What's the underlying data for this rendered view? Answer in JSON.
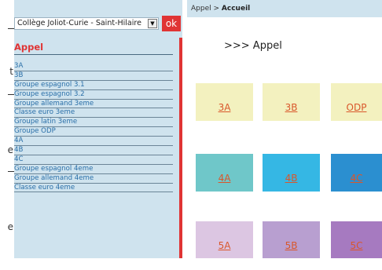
{
  "left_strip": {
    "fragments": [
      "t",
      "e",
      "e"
    ]
  },
  "sidebar": {
    "school_select_value": "Collège Joliot-Curie - Saint-Hilaire",
    "ok_label": "ok",
    "section_title": "Appel",
    "items": [
      "3A",
      "3B",
      "Groupe espagnol 3.1",
      "Groupe espagnol 3.2",
      "Groupe allemand 3eme",
      "Classe euro 3eme",
      "Groupe latin 3eme",
      "Groupe ODP",
      "4A",
      "4B",
      "4C",
      "Groupe espagnol 4eme",
      "Groupe allemand 4eme",
      "Classe euro 4eme"
    ]
  },
  "main": {
    "breadcrumb_root": "Appel",
    "breadcrumb_sep": ">",
    "breadcrumb_current": "Accueil",
    "title": ">>> Appel",
    "tiles": [
      {
        "label": "3A",
        "bg": "#f3f1bf",
        "fg": "#d9572b"
      },
      {
        "label": "3B",
        "bg": "#f3f1bf",
        "fg": "#d9572b"
      },
      {
        "label": "ODP",
        "bg": "#f3f1bf",
        "fg": "#d9572b"
      },
      {
        "label": "4A",
        "bg": "#6fc7c9",
        "fg": "#d9572b"
      },
      {
        "label": "4B",
        "bg": "#35b7e4",
        "fg": "#d9572b"
      },
      {
        "label": "4C",
        "bg": "#2b8fd0",
        "fg": "#d9572b"
      },
      {
        "label": "5A",
        "bg": "#dcc6e2",
        "fg": "#d9572b"
      },
      {
        "label": "5B",
        "bg": "#b89fd0",
        "fg": "#d9572b"
      },
      {
        "label": "5C",
        "bg": "#a67ac0",
        "fg": "#d9572b"
      }
    ]
  },
  "colors": {
    "accent_red": "#e03434",
    "sidebar_bg": "#cfe3ee",
    "link_blue": "#2a6fa8"
  }
}
